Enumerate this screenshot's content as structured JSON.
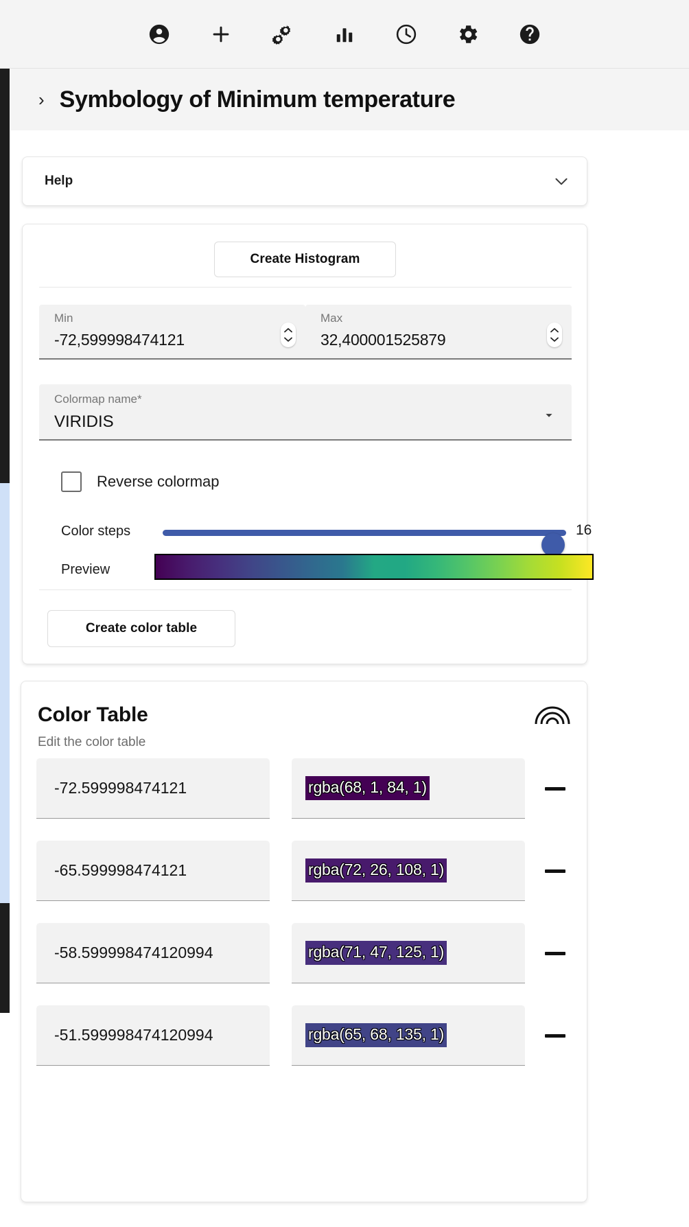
{
  "toolbar": {
    "icons": [
      {
        "name": "account-circle-icon",
        "label": "Account"
      },
      {
        "name": "add-icon",
        "label": "Add"
      },
      {
        "name": "gears-icon",
        "label": "Processes"
      },
      {
        "name": "bar-chart-icon",
        "label": "Statistics"
      },
      {
        "name": "clock-icon",
        "label": "History"
      },
      {
        "name": "gear-icon",
        "label": "Settings"
      },
      {
        "name": "help-icon",
        "label": "Help"
      }
    ]
  },
  "page_header": {
    "chevron": "›",
    "title": "Symbology of Minimum temperature"
  },
  "help_panel": {
    "label": "Help"
  },
  "symbology": {
    "create_histogram_label": "Create Histogram",
    "min": {
      "label": "Min",
      "value": "-72,599998474121"
    },
    "max": {
      "label": "Max",
      "value": "32,400001525879"
    },
    "colormap": {
      "label": "Colormap name*",
      "value": "VIRIDIS"
    },
    "reverse_colormap": {
      "label": "Reverse colormap",
      "checked": false
    },
    "color_steps": {
      "label": "Color steps",
      "value": "16"
    },
    "preview": {
      "label": "Preview"
    },
    "create_color_table_label": "Create color table"
  },
  "color_table": {
    "title": "Color Table",
    "subtitle": "Edit the color table",
    "rows": [
      {
        "value": "-72.599998474121",
        "color": "rgba(68, 1, 84, 1)",
        "swatch": "#44015 4"
      },
      {
        "value": "-65.599998474121",
        "color": "rgba(72, 26, 108, 1)",
        "swatch": "#481a6c"
      },
      {
        "value": "-58.599998474120994",
        "color": "rgba(71, 47, 125, 1)",
        "swatch": "#472f7d"
      },
      {
        "value": "-51.599998474120994",
        "color": "rgba(65, 68, 135, 1)",
        "swatch": "#414487"
      }
    ]
  },
  "colors": {
    "accent_blue": "#3f5ba9",
    "toolbar_bg": "#f4f4f4",
    "header_bg": "#f4f4f4",
    "field_bg": "#f2f2f2"
  }
}
